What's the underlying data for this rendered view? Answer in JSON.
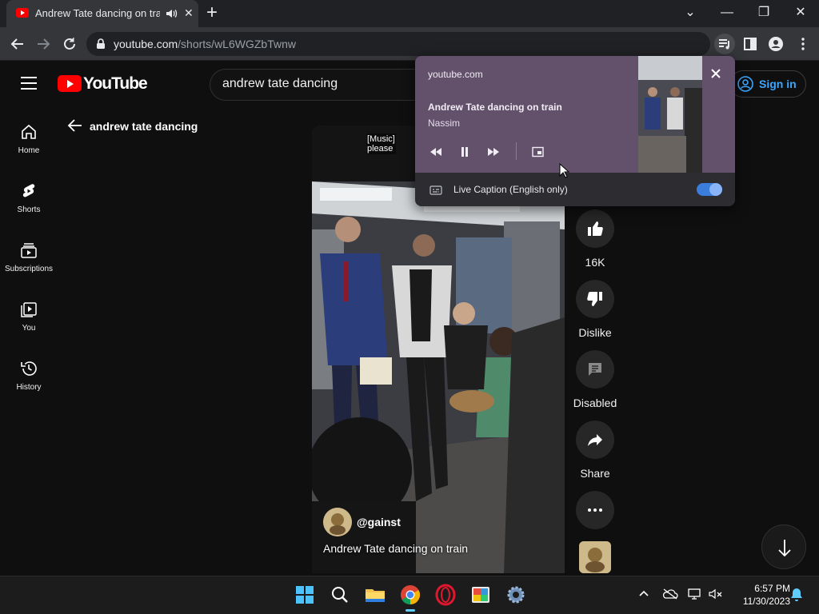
{
  "browser": {
    "tab": {
      "title": "Andrew Tate dancing on train",
      "close": "✕"
    },
    "new_tab": "+",
    "window_controls": {
      "list": "⌄",
      "minimize": "—",
      "restore": "❐",
      "close": "✕"
    },
    "url_host": "youtube.com",
    "url_path": "/shorts/wL6WGZbTwnw"
  },
  "youtube": {
    "logo_text": "YouTube",
    "search_query": "andrew tate dancing",
    "sign_in": "Sign in",
    "back_label": "andrew tate dancing",
    "nav": [
      {
        "label": "Home",
        "icon": "home-icon"
      },
      {
        "label": "Shorts",
        "icon": "shorts-icon"
      },
      {
        "label": "Subscriptions",
        "icon": "subscriptions-icon"
      },
      {
        "label": "You",
        "icon": "you-icon"
      },
      {
        "label": "History",
        "icon": "history-icon"
      }
    ],
    "video": {
      "caption_line1": "[Music]",
      "caption_line2": "please",
      "channel": "@gainst",
      "title": "Andrew Tate dancing on train"
    },
    "actions": {
      "like_count": "16K",
      "dislike": "Dislike",
      "comments": "Disabled",
      "share": "Share"
    }
  },
  "media_popup": {
    "origin": "youtube.com",
    "title": "Andrew Tate dancing on train",
    "artist": "Nassim",
    "live_caption": "Live Caption (English only)",
    "live_caption_on": true
  },
  "taskbar": {
    "time": "6:57 PM",
    "date": "11/30/2023",
    "accent": "#60cdff"
  }
}
